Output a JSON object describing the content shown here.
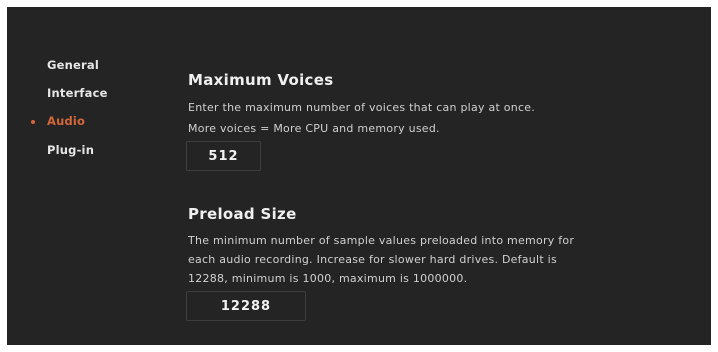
{
  "sidebar": {
    "items": [
      {
        "label": "General",
        "active": false
      },
      {
        "label": "Interface",
        "active": false
      },
      {
        "label": "Audio",
        "active": true
      },
      {
        "label": "Plug-in",
        "active": false
      }
    ]
  },
  "max_voices": {
    "title": "Maximum Voices",
    "description": [
      "Enter the maximum number of voices that can play at once.",
      "More voices = More CPU and memory used."
    ],
    "value": "512"
  },
  "preload_size": {
    "title": "Preload Size",
    "description": [
      "The minimum number of sample values preloaded into memory for",
      "each audio recording. Increase for slower hard drives. Default is",
      "12288, minimum is 1000, maximum is 1000000."
    ],
    "value": "12288"
  },
  "colors": {
    "background": "#242424",
    "accent": "#d4673a",
    "text": "#e6e6e6"
  }
}
